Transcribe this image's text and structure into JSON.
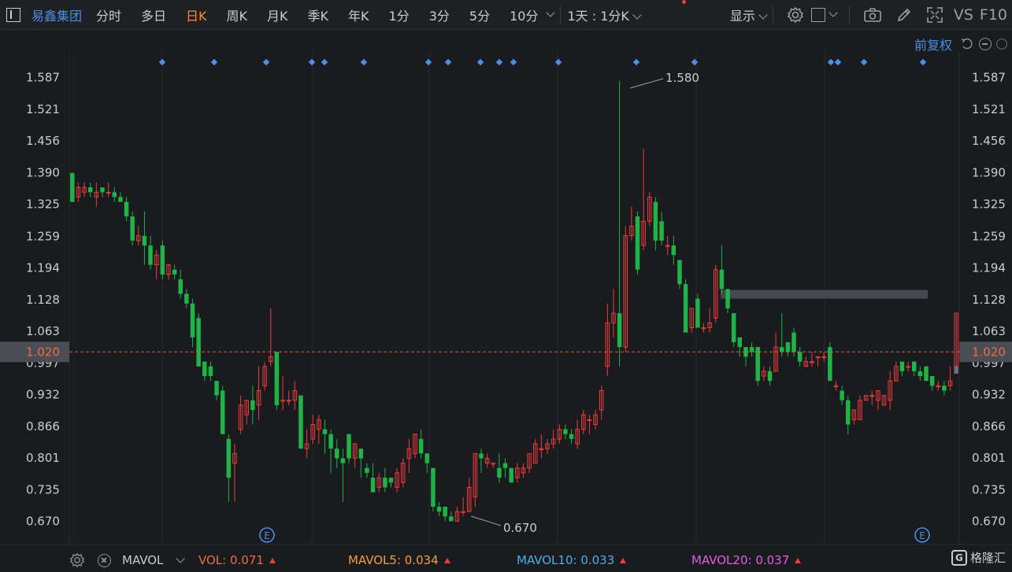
{
  "toolbar": {
    "stock_name": "易鑫集团",
    "periods": [
      "分时",
      "多日",
      "日K",
      "周K",
      "月K",
      "季K",
      "年K",
      "1分",
      "3分",
      "5分",
      "10分"
    ],
    "active_period": "日K",
    "interval_select": "1天 : 1分K",
    "display_label": "显示",
    "right_tools": [
      "settings-icon",
      "square-icon",
      "camera-icon",
      "pen-icon",
      "fullscreen-icon"
    ],
    "vs_label": "VS",
    "f10_label": "F10"
  },
  "adjust": {
    "label": "前复权"
  },
  "chart_data": {
    "type": "candlestick",
    "y_ticks": [
      "1.587",
      "1.521",
      "1.456",
      "1.390",
      "1.325",
      "1.259",
      "1.194",
      "1.128",
      "1.063",
      "0.997",
      "0.932",
      "0.866",
      "0.801",
      "0.735",
      "0.670"
    ],
    "ylim": [
      0.622,
      1.64
    ],
    "current_price": "1.020",
    "max_label": "1.580",
    "min_label": "0.670",
    "colors": {
      "up": "#f03c3c",
      "down": "#1fb348",
      "ref_line": "#e05a3a",
      "marker": "#4a8fe0",
      "bg": "#1a1b1e"
    },
    "candles": [
      [
        1.39,
        1.33,
        1.39,
        1.33
      ],
      [
        1.34,
        1.36,
        1.37,
        1.33
      ],
      [
        1.35,
        1.36,
        1.37,
        1.34
      ],
      [
        1.36,
        1.35,
        1.37,
        1.34
      ],
      [
        1.34,
        1.35,
        1.37,
        1.32
      ],
      [
        1.36,
        1.35,
        1.36,
        1.34
      ],
      [
        1.35,
        1.35,
        1.37,
        1.34
      ],
      [
        1.35,
        1.34,
        1.36,
        1.33
      ],
      [
        1.34,
        1.33,
        1.35,
        1.33
      ],
      [
        1.33,
        1.3,
        1.34,
        1.29
      ],
      [
        1.3,
        1.25,
        1.31,
        1.24
      ],
      [
        1.25,
        1.26,
        1.28,
        1.24
      ],
      [
        1.26,
        1.24,
        1.31,
        1.2
      ],
      [
        1.24,
        1.2,
        1.26,
        1.19
      ],
      [
        1.2,
        1.22,
        1.23,
        1.17
      ],
      [
        1.24,
        1.18,
        1.25,
        1.17
      ],
      [
        1.18,
        1.2,
        1.2,
        1.17
      ],
      [
        1.19,
        1.18,
        1.2,
        1.17
      ],
      [
        1.17,
        1.14,
        1.19,
        1.13
      ],
      [
        1.14,
        1.12,
        1.15,
        1.11
      ],
      [
        1.12,
        1.05,
        1.13,
        1.03
      ],
      [
        1.09,
        0.99,
        1.1,
        0.99
      ],
      [
        1.0,
        0.97,
        1.0,
        0.96
      ],
      [
        0.99,
        0.97,
        1.0,
        0.96
      ],
      [
        0.96,
        0.93,
        0.96,
        0.92
      ],
      [
        0.94,
        0.85,
        0.95,
        0.85
      ],
      [
        0.84,
        0.76,
        0.85,
        0.71
      ],
      [
        0.79,
        0.81,
        0.83,
        0.71
      ],
      [
        0.86,
        0.91,
        0.93,
        0.85
      ],
      [
        0.89,
        0.92,
        0.92,
        0.87
      ],
      [
        0.92,
        0.9,
        0.95,
        0.87
      ],
      [
        0.91,
        0.94,
        0.99,
        0.88
      ],
      [
        0.95,
        0.99,
        1.0,
        0.94
      ],
      [
        1.0,
        1.01,
        1.11,
        0.99
      ],
      [
        1.02,
        0.91,
        1.02,
        0.9
      ],
      [
        0.92,
        0.92,
        0.97,
        0.9
      ],
      [
        0.92,
        0.92,
        0.94,
        0.91
      ],
      [
        0.92,
        0.94,
        0.96,
        0.9
      ],
      [
        0.93,
        0.82,
        0.93,
        0.82
      ],
      [
        0.82,
        0.83,
        0.86,
        0.8
      ],
      [
        0.84,
        0.87,
        0.89,
        0.83
      ],
      [
        0.86,
        0.88,
        0.89,
        0.83
      ],
      [
        0.86,
        0.85,
        0.88,
        0.81
      ],
      [
        0.85,
        0.82,
        0.86,
        0.77
      ],
      [
        0.82,
        0.8,
        0.84,
        0.78
      ],
      [
        0.8,
        0.79,
        0.82,
        0.71
      ],
      [
        0.85,
        0.8,
        0.85,
        0.79
      ],
      [
        0.8,
        0.83,
        0.83,
        0.78
      ],
      [
        0.82,
        0.8,
        0.82,
        0.76
      ],
      [
        0.78,
        0.77,
        0.79,
        0.76
      ],
      [
        0.76,
        0.73,
        0.79,
        0.73
      ],
      [
        0.74,
        0.76,
        0.77,
        0.73
      ],
      [
        0.76,
        0.74,
        0.78,
        0.73
      ],
      [
        0.76,
        0.75,
        0.76,
        0.74
      ],
      [
        0.74,
        0.77,
        0.78,
        0.73
      ],
      [
        0.75,
        0.79,
        0.8,
        0.74
      ],
      [
        0.8,
        0.82,
        0.84,
        0.77
      ],
      [
        0.81,
        0.85,
        0.85,
        0.8
      ],
      [
        0.84,
        0.81,
        0.86,
        0.8
      ],
      [
        0.81,
        0.79,
        0.81,
        0.77
      ],
      [
        0.78,
        0.7,
        0.78,
        0.69
      ],
      [
        0.7,
        0.69,
        0.71,
        0.68
      ],
      [
        0.7,
        0.68,
        0.7,
        0.67
      ],
      [
        0.68,
        0.67,
        0.69,
        0.67
      ],
      [
        0.67,
        0.69,
        0.7,
        0.67
      ],
      [
        0.69,
        0.69,
        0.72,
        0.68
      ],
      [
        0.69,
        0.74,
        0.76,
        0.69
      ],
      [
        0.72,
        0.81,
        0.81,
        0.7
      ],
      [
        0.81,
        0.8,
        0.82,
        0.77
      ],
      [
        0.79,
        0.8,
        0.81,
        0.78
      ],
      [
        0.79,
        0.79,
        0.79,
        0.78
      ],
      [
        0.78,
        0.76,
        0.81,
        0.75
      ],
      [
        0.79,
        0.78,
        0.8,
        0.76
      ],
      [
        0.78,
        0.75,
        0.78,
        0.75
      ],
      [
        0.76,
        0.78,
        0.79,
        0.75
      ],
      [
        0.77,
        0.78,
        0.79,
        0.76
      ],
      [
        0.78,
        0.81,
        0.81,
        0.77
      ],
      [
        0.79,
        0.83,
        0.84,
        0.79
      ],
      [
        0.82,
        0.82,
        0.85,
        0.8
      ],
      [
        0.82,
        0.83,
        0.84,
        0.81
      ],
      [
        0.83,
        0.84,
        0.86,
        0.82
      ],
      [
        0.84,
        0.86,
        0.87,
        0.83
      ],
      [
        0.86,
        0.85,
        0.87,
        0.84
      ],
      [
        0.85,
        0.84,
        0.86,
        0.83
      ],
      [
        0.83,
        0.86,
        0.88,
        0.82
      ],
      [
        0.86,
        0.89,
        0.9,
        0.85
      ],
      [
        0.88,
        0.88,
        0.89,
        0.85
      ],
      [
        0.87,
        0.89,
        0.9,
        0.86
      ],
      [
        0.9,
        0.94,
        0.95,
        0.88
      ],
      [
        0.99,
        1.08,
        1.12,
        0.97
      ],
      [
        1.08,
        1.1,
        1.15,
        1.05
      ],
      [
        1.1,
        1.03,
        1.58,
        0.99
      ],
      [
        1.03,
        1.26,
        1.28,
        1.02
      ],
      [
        1.26,
        1.28,
        1.32,
        1.25
      ],
      [
        1.3,
        1.19,
        1.31,
        1.18
      ],
      [
        1.24,
        1.29,
        1.44,
        1.23
      ],
      [
        1.29,
        1.34,
        1.35,
        1.28
      ],
      [
        1.33,
        1.25,
        1.34,
        1.23
      ],
      [
        1.29,
        1.25,
        1.31,
        1.24
      ],
      [
        1.24,
        1.24,
        1.26,
        1.22
      ],
      [
        1.24,
        1.22,
        1.26,
        1.2
      ],
      [
        1.21,
        1.16,
        1.21,
        1.15
      ],
      [
        1.16,
        1.06,
        1.17,
        1.06
      ],
      [
        1.07,
        1.11,
        1.11,
        1.06
      ],
      [
        1.13,
        1.07,
        1.14,
        1.07
      ],
      [
        1.07,
        1.07,
        1.08,
        1.06
      ],
      [
        1.07,
        1.08,
        1.11,
        1.06
      ],
      [
        1.09,
        1.19,
        1.2,
        1.08
      ],
      [
        1.19,
        1.15,
        1.24,
        1.14
      ],
      [
        1.15,
        1.11,
        1.15,
        1.1
      ],
      [
        1.1,
        1.04,
        1.1,
        1.03
      ],
      [
        1.05,
        1.03,
        1.05,
        1.01
      ],
      [
        1.03,
        1.01,
        1.03,
        0.99
      ],
      [
        1.03,
        1.02,
        1.04,
        1.01
      ],
      [
        1.03,
        0.96,
        1.03,
        0.95
      ],
      [
        0.97,
        0.98,
        0.99,
        0.96
      ],
      [
        0.98,
        0.96,
        0.99,
        0.95
      ],
      [
        0.98,
        1.03,
        1.06,
        0.98
      ],
      [
        1.03,
        1.02,
        1.1,
        1.01
      ],
      [
        1.04,
        1.02,
        1.04,
        1.01
      ],
      [
        1.06,
        1.02,
        1.07,
        1.01
      ],
      [
        1.02,
        1.0,
        1.03,
        0.99
      ],
      [
        0.99,
        1.0,
        1.01,
        0.99
      ],
      [
        1.0,
        1.0,
        1.02,
        0.99
      ],
      [
        1.01,
        1.01,
        1.01,
        0.99
      ],
      [
        1.01,
        1.01,
        1.02,
        1.0
      ],
      [
        1.03,
        0.96,
        1.04,
        0.96
      ],
      [
        0.95,
        0.95,
        0.96,
        0.94
      ],
      [
        0.94,
        0.92,
        0.95,
        0.91
      ],
      [
        0.92,
        0.87,
        0.93,
        0.85
      ],
      [
        0.88,
        0.9,
        0.9,
        0.87
      ],
      [
        0.88,
        0.92,
        0.93,
        0.88
      ],
      [
        0.92,
        0.93,
        0.93,
        0.92
      ],
      [
        0.93,
        0.93,
        0.94,
        0.91
      ],
      [
        0.92,
        0.94,
        0.94,
        0.9
      ],
      [
        0.91,
        0.93,
        0.93,
        0.91
      ],
      [
        0.92,
        0.96,
        0.98,
        0.9
      ],
      [
        0.96,
        0.99,
        1.0,
        0.96
      ],
      [
        1.0,
        0.98,
        1.0,
        0.97
      ],
      [
        0.99,
        0.99,
        1.0,
        0.98
      ],
      [
        1.0,
        0.98,
        1.0,
        0.97
      ],
      [
        0.98,
        0.97,
        0.99,
        0.96
      ],
      [
        0.99,
        0.96,
        0.99,
        0.96
      ],
      [
        0.97,
        0.95,
        0.97,
        0.94
      ],
      [
        0.95,
        0.95,
        0.96,
        0.94
      ],
      [
        0.95,
        0.94,
        0.96,
        0.93
      ],
      [
        0.95,
        0.96,
        0.99,
        0.94
      ],
      [
        0.99,
        1.1,
        1.1,
        0.98
      ]
    ],
    "plot": {
      "x_start": 88,
      "x_end": 1218,
      "y_top": 66,
      "y_bottom": 692
    },
    "marker_x": [
      206,
      272,
      338,
      396,
      412,
      462,
      544,
      569,
      610,
      634,
      652,
      709,
      808,
      882,
      1055,
      1064,
      1097,
      1172
    ],
    "vgrid_x": [
      206,
      397,
      545,
      708,
      884,
      1047
    ],
    "ex_markers": [
      "E",
      "E"
    ],
    "resistance_band": [
      1.148,
      1.13
    ]
  },
  "indicators": {
    "mavol_label": "MAVOL",
    "items": [
      {
        "label": "VOL: 0.071",
        "color": "#f06a48"
      },
      {
        "label": "MAVOL5: 0.034",
        "color": "#f0a040"
      },
      {
        "label": "MAVOL10: 0.033",
        "color": "#4ab0e8"
      },
      {
        "label": "MAVOL20: 0.037",
        "color": "#e060e0"
      }
    ]
  },
  "watermark": {
    "text": "格隆汇"
  }
}
